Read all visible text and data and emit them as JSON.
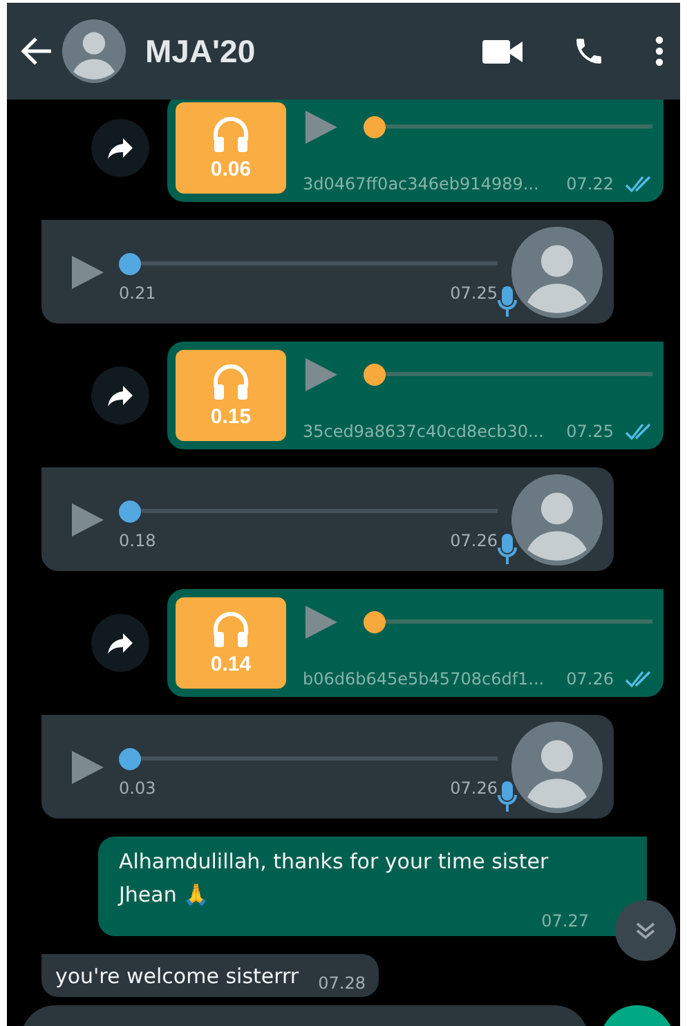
{
  "header": {
    "title": "MJA'20"
  },
  "messages": [
    {
      "kind": "sent-audio",
      "duration": "0.06",
      "filename": "3d0467ff0ac346eb914989...",
      "time": "07.22",
      "level": 0,
      "read": true
    },
    {
      "kind": "received-voice",
      "elapsed": "0.21",
      "time": "07.25",
      "level": 0
    },
    {
      "kind": "sent-audio",
      "duration": "0.15",
      "filename": "35ced9a8637c40cd8ecb30...",
      "time": "07.25",
      "level": 0,
      "read": true
    },
    {
      "kind": "received-voice",
      "elapsed": "0.18",
      "time": "07.26",
      "level": 0
    },
    {
      "kind": "sent-audio",
      "duration": "0.14",
      "filename": "b06d6b645e5b45708c6df1...",
      "time": "07.26",
      "level": 0,
      "read": true
    },
    {
      "kind": "received-voice",
      "elapsed": "0.03",
      "time": "07.26",
      "level": 0
    },
    {
      "kind": "sent-text",
      "text": "Alhamdulillah, thanks for your time sister Jhean 🙏",
      "time": "07.27"
    },
    {
      "kind": "received-text",
      "text": "you're welcome sisterrr",
      "time": "07.28"
    }
  ]
}
